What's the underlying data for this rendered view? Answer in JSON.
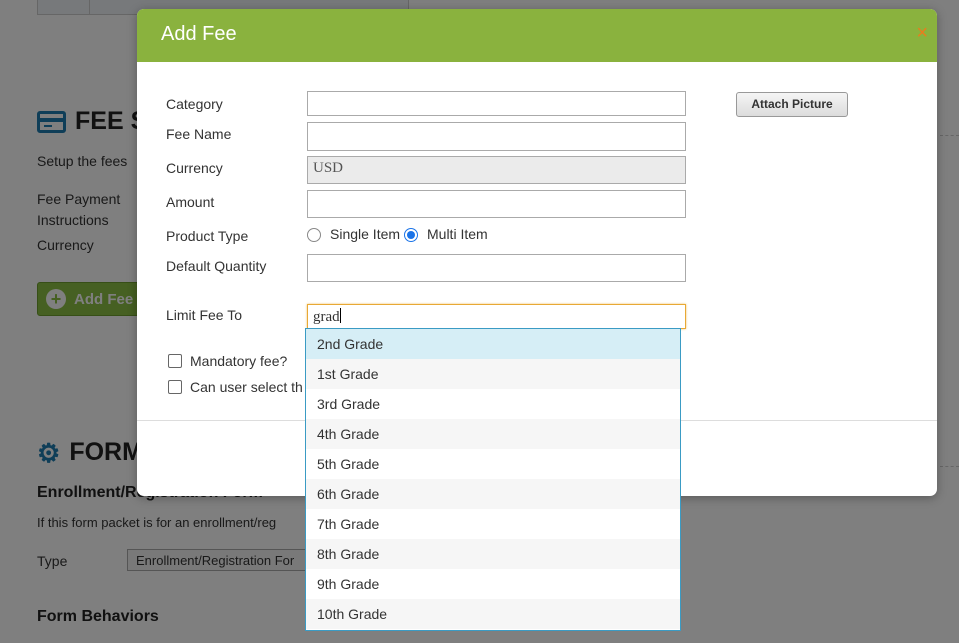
{
  "background": {
    "section1": {
      "title": "FEE S",
      "description": "Setup the fees"
    },
    "fee_payment_label_line1": "Fee Payment",
    "fee_payment_label_line2": "Instructions",
    "currency_label": "Currency",
    "add_fee_button": "Add Fee",
    "section2": {
      "title": "FORM"
    },
    "enrollment_heading": "Enrollment/Registration Form",
    "enrollment_description": "If this form packet is for an enrollment/reg",
    "type_label": "Type",
    "type_value": "Enrollment/Registration For",
    "form_behaviors_heading": "Form Behaviors"
  },
  "modal": {
    "title": "Add Fee",
    "close_glyph": "×",
    "attach_button": "Attach Picture",
    "fields": {
      "category": {
        "label": "Category",
        "value": ""
      },
      "fee_name": {
        "label": "Fee Name",
        "value": ""
      },
      "currency": {
        "label": "Currency",
        "value": "USD"
      },
      "amount": {
        "label": "Amount",
        "value": ""
      },
      "product_type": {
        "label": "Product Type",
        "options": [
          "Single Item",
          "Multi Item"
        ],
        "selected": "Multi Item"
      },
      "default_quantity": {
        "label": "Default Quantity",
        "value": ""
      },
      "limit_fee_to": {
        "label": "Limit Fee To",
        "value": "grad"
      }
    },
    "checkboxes": [
      {
        "label": "Mandatory fee?",
        "checked": false
      },
      {
        "label": "Can user select th",
        "checked": false
      }
    ]
  },
  "autocomplete": {
    "highlighted": "2nd Grade",
    "items": [
      "2nd Grade",
      "1st Grade",
      "3rd Grade",
      "4th Grade",
      "5th Grade",
      "6th Grade",
      "7th Grade",
      "8th Grade",
      "9th Grade",
      "10th Grade"
    ]
  },
  "colors": {
    "header_green": "#8ab23e",
    "close_orange": "#e87d1e",
    "accent_blue": "#1f7db0",
    "dropdown_highlight": "#d6eef6"
  }
}
